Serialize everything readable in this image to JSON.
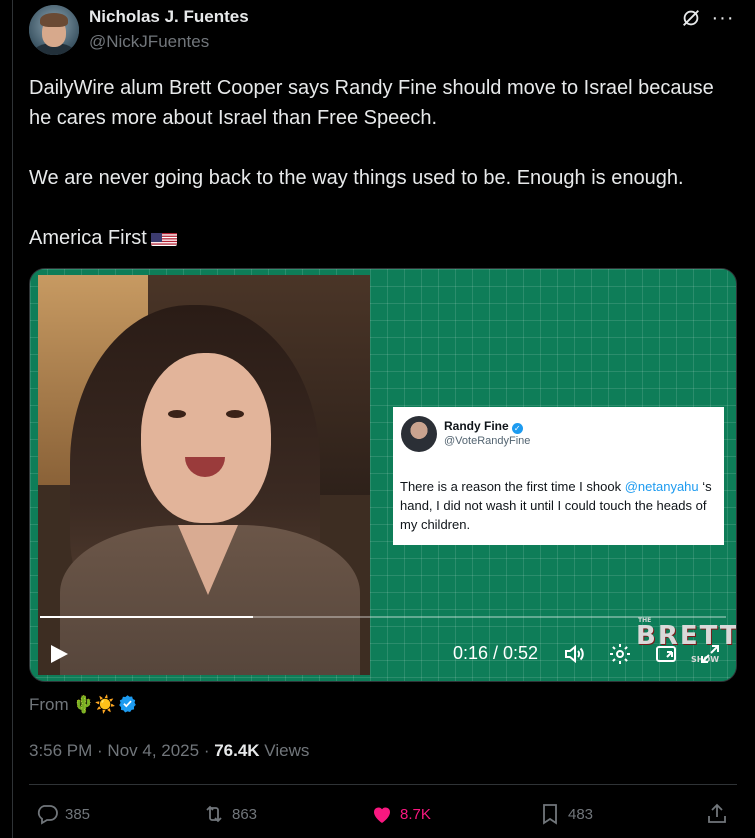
{
  "author": {
    "name": "Nicholas J. Fuentes",
    "handle": "@NickJFuentes"
  },
  "tweet": {
    "paragraph1": "DailyWire alum Brett Cooper says Randy Fine should move to Israel because he cares more about Israel than Free Speech.",
    "paragraph2": "We are never going back to the way things used to be. Enough is enough.",
    "paragraph3": "America First"
  },
  "video": {
    "embedded_card": {
      "name": "Randy Fine",
      "handle": "@VoteRandyFine",
      "text_before": "There is a reason the first time I shook ",
      "mention": "@netanyahu",
      "text_after": " ‘s hand, I did not wash it until I could touch the heads of my children."
    },
    "logo": {
      "the": "THE",
      "big": "BRETT",
      "small": "SHOW"
    },
    "time": "0:16 / 0:52",
    "progress": 0.31
  },
  "from": {
    "label": "From",
    "emojis": "🌵☀️"
  },
  "meta": {
    "time": "3:56 PM · Nov 4, 2025 · ",
    "views_count": "76.4K",
    "views_label": " Views"
  },
  "actions": {
    "replies": "385",
    "reposts": "863",
    "likes": "8.7K",
    "bookmarks": "483"
  },
  "colors": {
    "accent": "#1d9bf0",
    "like": "#f91880",
    "muted": "#71767b"
  }
}
